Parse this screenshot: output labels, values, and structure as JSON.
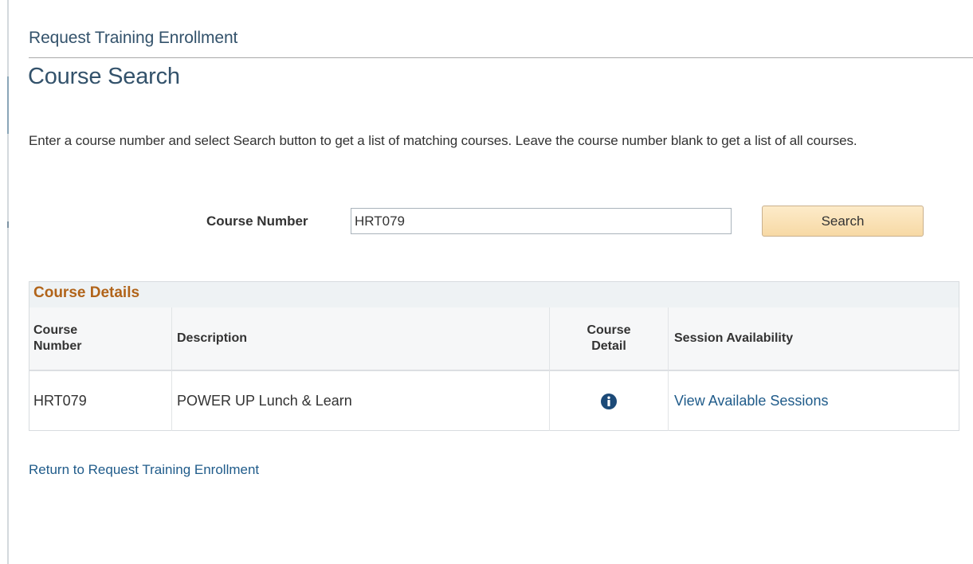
{
  "breadcrumb": "Request Training Enrollment",
  "page_title": "Course Search",
  "instructions": "Enter a course number and select Search button to get a list of matching courses.  Leave the course number blank to get a list of all courses.",
  "search": {
    "label": "Course Number",
    "value": "HRT079",
    "button_label": "Search"
  },
  "grid": {
    "title": "Course Details",
    "columns": {
      "course_number": "Course Number",
      "description": "Description",
      "course_detail": "Course Detail",
      "session_availability": "Session Availability"
    },
    "rows": [
      {
        "course_number": "HRT079",
        "description": "POWER UP Lunch & Learn",
        "detail_icon": "info-icon",
        "session_link": "View Available Sessions"
      }
    ]
  },
  "return_link": "Return to Request Training Enrollment",
  "colors": {
    "title": "#33526b",
    "grid_title": "#b1641a",
    "link": "#1f5b8a",
    "button": "#f7d9a5",
    "info_icon": "#1c4a78"
  }
}
